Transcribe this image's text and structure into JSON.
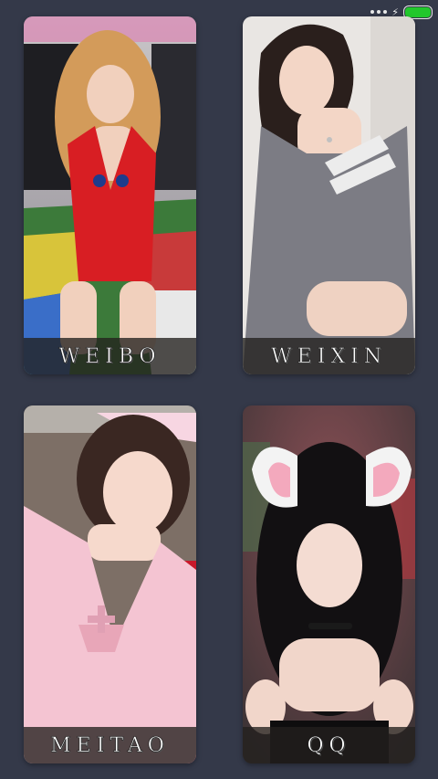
{
  "status_bar": {
    "charging_icon": "lightning-bolt-icon",
    "battery_level": 1.0,
    "battery_color": "#22c72c"
  },
  "cards": [
    {
      "label": "WEIBO"
    },
    {
      "label": "WEIXIN"
    },
    {
      "label": "MEITAO"
    },
    {
      "label": "QQ"
    }
  ],
  "colors": {
    "background": "#343949",
    "label_bar": "#23201e"
  }
}
